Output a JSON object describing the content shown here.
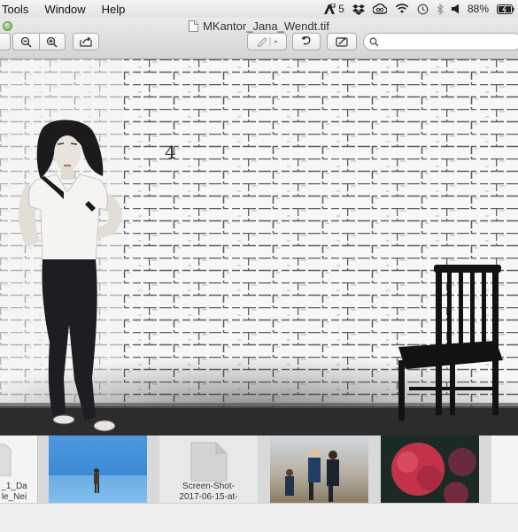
{
  "menu": {
    "items": [
      "Tools",
      "Window",
      "Help"
    ]
  },
  "status": {
    "adobe_count": "5",
    "battery": "88%"
  },
  "window": {
    "title": "MKantor_Jana_Wendt.tif"
  },
  "image": {
    "wall_number": "4"
  },
  "thumbnails": [
    {
      "label_lines": [
        "_1_Da",
        "le_Nei"
      ]
    },
    {
      "label_lines": []
    },
    {
      "label_lines": [
        "Screen-Shot-",
        "2017-06-15-at-"
      ]
    },
    {
      "label_lines": []
    },
    {
      "label_lines": []
    }
  ],
  "colors": {
    "accent_green": "#8cc26b",
    "window_bg": "#ececec"
  }
}
